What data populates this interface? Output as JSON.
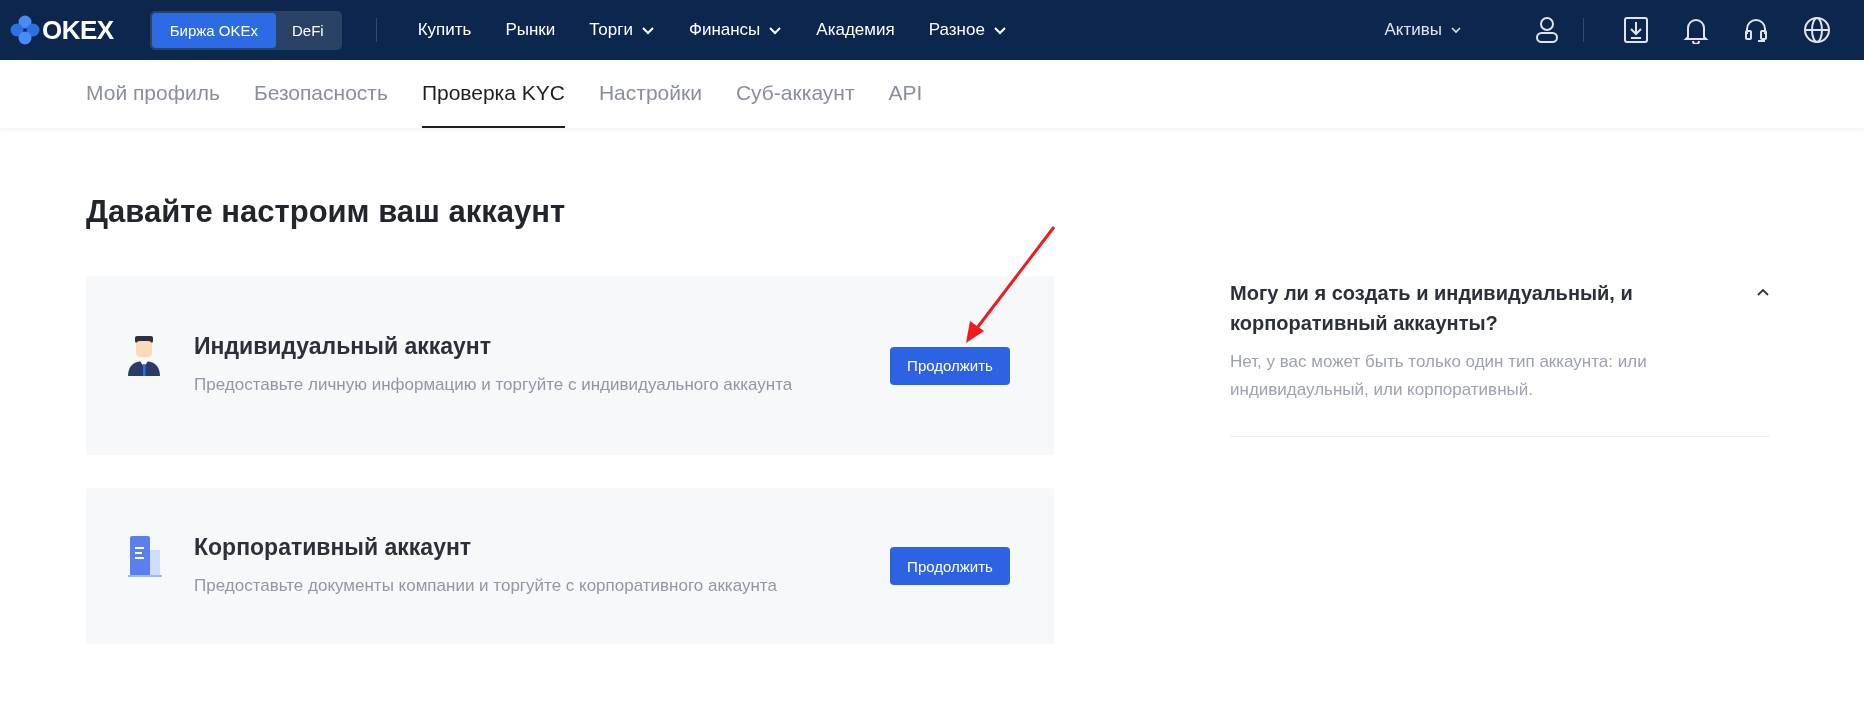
{
  "header": {
    "logo": "OKEX",
    "exchange_switch": [
      {
        "label": "Биржа OKEx",
        "selected": true
      },
      {
        "label": "DeFi",
        "selected": false
      }
    ],
    "nav": [
      {
        "label": "Купить",
        "dropdown": false
      },
      {
        "label": "Рынки",
        "dropdown": false
      },
      {
        "label": "Торги",
        "dropdown": true
      },
      {
        "label": "Финансы",
        "dropdown": true
      },
      {
        "label": "Академия",
        "dropdown": false
      },
      {
        "label": "Разное",
        "dropdown": true
      }
    ],
    "assets": {
      "label": "Активы",
      "dropdown": true
    }
  },
  "subnav": [
    {
      "label": "Мой профиль",
      "selected": false
    },
    {
      "label": "Безопасность",
      "selected": false
    },
    {
      "label": "Проверка KYC",
      "selected": true
    },
    {
      "label": "Настройки",
      "selected": false
    },
    {
      "label": "Суб-аккаунт",
      "selected": false
    },
    {
      "label": "API",
      "selected": false
    }
  ],
  "page_title": "Давайте настроим ваш аккаунт",
  "account_types": [
    {
      "kind": "person",
      "title": "Индивидуальный аккаунт",
      "description": "Предоставьте личную информацию и торгуйте с индивидуального аккаунта",
      "button": "Продолжить"
    },
    {
      "kind": "building",
      "title": "Корпоративный аккаунт",
      "description": "Предоставьте документы компании и торгуйте с корпоративного аккаунта",
      "button": "Продолжить"
    }
  ],
  "faq": [
    {
      "question": "Могу ли я создать и индивидуальный, и корпоративный аккаунты?",
      "answer": "Нет, у вас может быть только один тип аккаунта: или индивидаульный, или корпоративный.",
      "expanded": true
    }
  ]
}
